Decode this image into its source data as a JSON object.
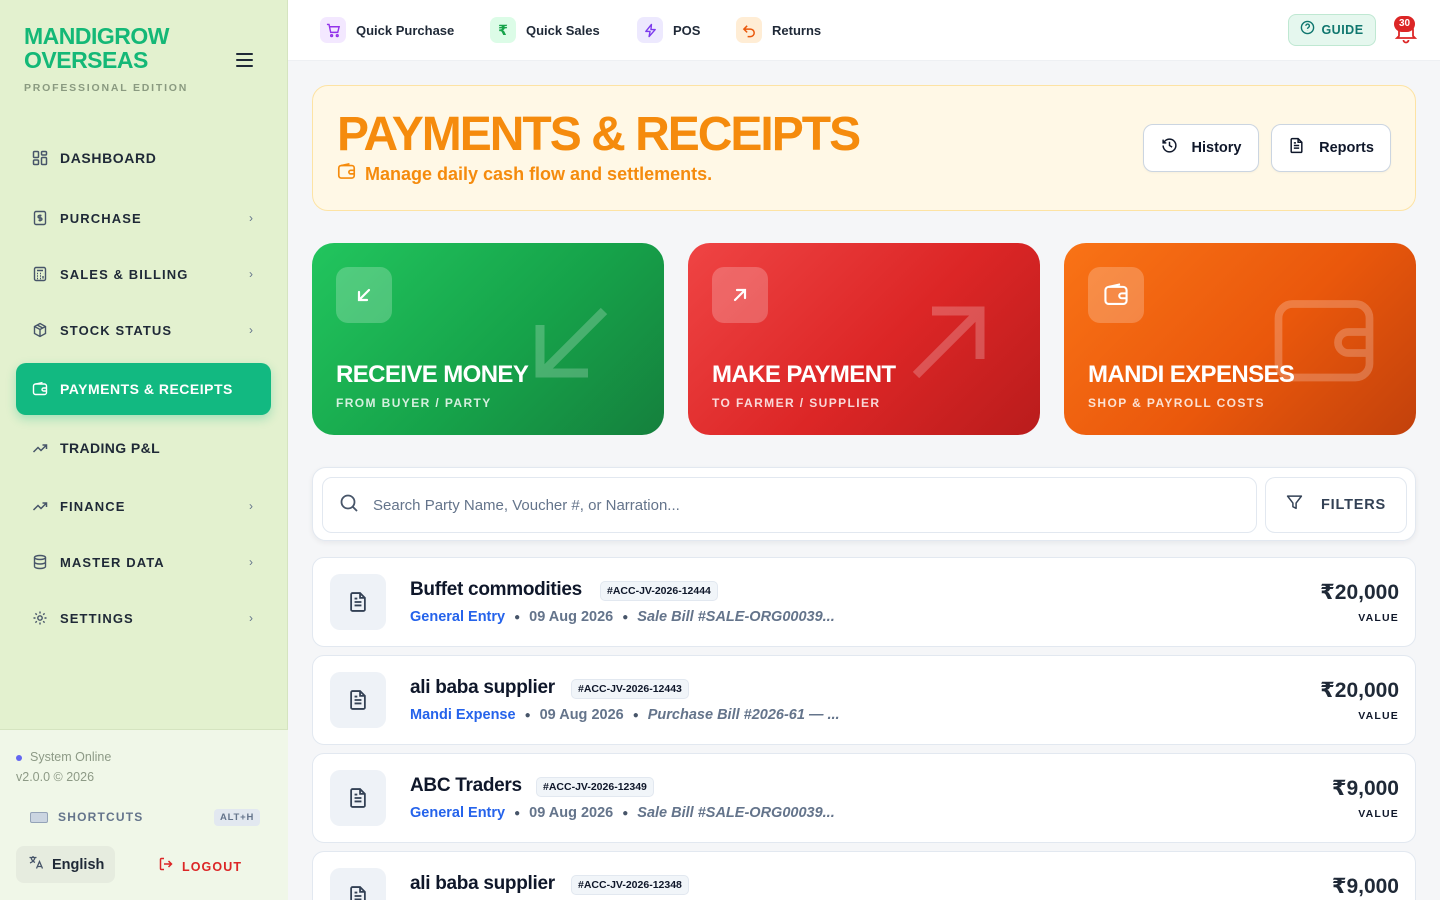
{
  "brand": {
    "line1": "MANDIGROW",
    "line2": "OVERSEAS",
    "edition": "PROFESSIONAL EDITION"
  },
  "sidebar": {
    "items": [
      {
        "label": "DASHBOARD",
        "icon": "dashboard-icon",
        "chevron": false,
        "active": false
      },
      {
        "label": "PURCHASE",
        "icon": "receipt-dollar-icon",
        "chevron": true,
        "active": false
      },
      {
        "label": "SALES & BILLING",
        "icon": "calculator-icon",
        "chevron": true,
        "active": false
      },
      {
        "label": "STOCK STATUS",
        "icon": "box-icon",
        "chevron": true,
        "active": false
      },
      {
        "label": "PAYMENTS & RECEIPTS",
        "icon": "wallet-icon",
        "chevron": false,
        "active": true
      },
      {
        "label": "TRADING P&L",
        "icon": "trending-up-icon",
        "chevron": false,
        "active": false
      },
      {
        "label": "FINANCE",
        "icon": "trending-up-icon",
        "chevron": true,
        "active": false
      },
      {
        "label": "MASTER DATA",
        "icon": "database-icon",
        "chevron": true,
        "active": false
      },
      {
        "label": "SETTINGS",
        "icon": "gear-icon",
        "chevron": true,
        "active": false
      }
    ],
    "footer": {
      "status": "System Online",
      "version": "v2.0.0 © 2026",
      "shortcuts_label": "SHORTCUTS",
      "shortcuts_key": "ALT+H",
      "language": "English",
      "logout": "LOGOUT"
    }
  },
  "topbar": {
    "quick_actions": [
      {
        "label": "Quick Purchase",
        "icon": "cart-icon",
        "bg": "#f3e8ff",
        "fg": "#9333ea"
      },
      {
        "label": "Quick Sales",
        "icon": "rupee-icon",
        "bg": "#dcfce7",
        "fg": "#16a34a"
      },
      {
        "label": "POS",
        "icon": "lightning-icon",
        "bg": "#ede9fe",
        "fg": "#7c3aed"
      },
      {
        "label": "Returns",
        "icon": "undo-icon",
        "bg": "#ffedd5",
        "fg": "#ea580c"
      }
    ],
    "guide_label": "GUIDE",
    "notification_count": "30"
  },
  "hero": {
    "title": "PAYMENTS & RECEIPTS",
    "subtitle": "Manage daily cash flow and settlements.",
    "history_label": "History",
    "reports_label": "Reports"
  },
  "cards": [
    {
      "title": "RECEIVE MONEY",
      "subtitle": "FROM BUYER / PARTY",
      "icon": "arrow-down-left-icon"
    },
    {
      "title": "MAKE PAYMENT",
      "subtitle": "TO FARMER / SUPPLIER",
      "icon": "arrow-up-right-icon"
    },
    {
      "title": "MANDI EXPENSES",
      "subtitle": "SHOP & PAYROLL COSTS",
      "icon": "wallet-icon"
    }
  ],
  "search": {
    "placeholder": "Search Party Name, Voucher #, or Narration...",
    "value": "",
    "filters_label": "FILTERS"
  },
  "entries": [
    {
      "party": "Buffet commodities",
      "voucher": "#ACC-JV-2026-12444",
      "type": "General Entry",
      "date": "09 Aug 2026",
      "narration": "Sale Bill #SALE-ORG00039...",
      "amount": "₹20,000",
      "caption": "VALUE"
    },
    {
      "party": "ali baba supplier",
      "voucher": "#ACC-JV-2026-12443",
      "type": "Mandi Expense",
      "date": "09 Aug 2026",
      "narration": "Purchase Bill #2026-61 — ...",
      "amount": "₹20,000",
      "caption": "VALUE"
    },
    {
      "party": "ABC Traders",
      "voucher": "#ACC-JV-2026-12349",
      "type": "General Entry",
      "date": "09 Aug 2026",
      "narration": "Sale Bill #SALE-ORG00039...",
      "amount": "₹9,000",
      "caption": "VALUE"
    },
    {
      "party": "ali baba supplier",
      "voucher": "#ACC-JV-2026-12348",
      "type": "",
      "date": "",
      "narration": "",
      "amount": "₹9,000",
      "caption": ""
    }
  ],
  "colors": {
    "accent": "#12b981",
    "hero_orange": "#f58b0d",
    "link_blue": "#2563eb"
  }
}
